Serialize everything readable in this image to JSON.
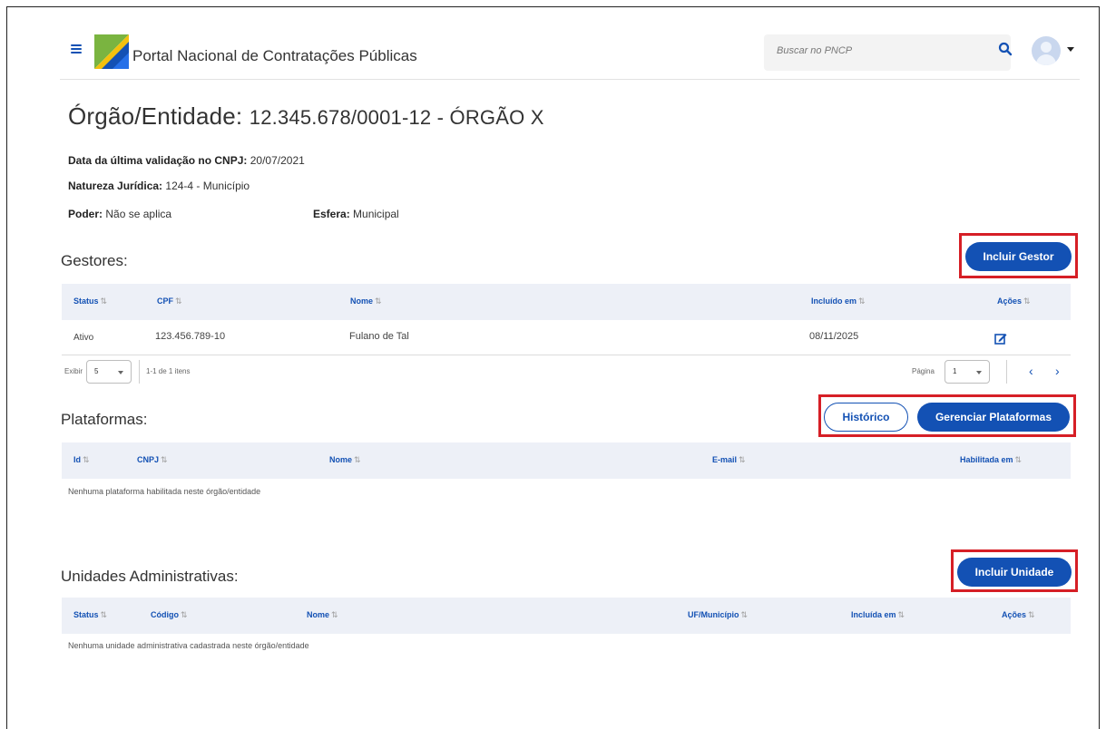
{
  "header": {
    "portal_title": "Portal Nacional de Contratações Públicas",
    "search_placeholder": "Buscar no PNCP"
  },
  "page": {
    "title_prefix": "Órgão/Entidade:",
    "title_value": "12.345.678/0001-12 - ÓRGÃO X"
  },
  "info": {
    "validation_label": "Data da última validação no CNPJ:",
    "validation_value": "20/07/2021",
    "natureza_label": "Natureza Jurídica:",
    "natureza_value": "124-4 - Município",
    "poder_label": "Poder:",
    "poder_value": "Não se aplica",
    "esfera_label": "Esfera:",
    "esfera_value": "Municipal"
  },
  "gestores": {
    "title": "Gestores:",
    "button": "Incluir Gestor",
    "columns": [
      "Status",
      "CPF",
      "Nome",
      "Incluído em",
      "Ações"
    ],
    "rows": [
      {
        "status": "Ativo",
        "cpf": "123.456.789-10",
        "nome": "Fulano de Tal",
        "incluido_em": "08/11/2025"
      }
    ],
    "pagination": {
      "show_label": "Exibir",
      "per_page": "5",
      "range_text": "1-1 de 1 itens",
      "page_label": "Página",
      "page_value": "1"
    }
  },
  "plataformas": {
    "title": "Plataformas:",
    "history_button": "Histórico",
    "manage_button": "Gerenciar Plataformas",
    "columns": [
      "Id",
      "CNPJ",
      "Nome",
      "E-mail",
      "Habilitada em"
    ],
    "empty_message": "Nenhuma plataforma habilitada neste órgão/entidade"
  },
  "unidades": {
    "title": "Unidades Administrativas:",
    "button": "Incluir Unidade",
    "columns": [
      "Status",
      "Código",
      "Nome",
      "UF/Município",
      "Incluída em",
      "Ações"
    ],
    "empty_message": "Nenhuma unidade administrativa cadastrada neste órgão/entidade"
  },
  "colors": {
    "primary": "#1351b4",
    "highlight": "#d61f26",
    "table_header_bg": "#edf0f7"
  },
  "icons": {
    "menu": "hamburger-icon",
    "search": "search-icon",
    "user": "avatar",
    "edit": "edit-icon",
    "prev": "chevron-left-icon",
    "next": "chevron-right-icon",
    "sort": "sort-icon"
  }
}
